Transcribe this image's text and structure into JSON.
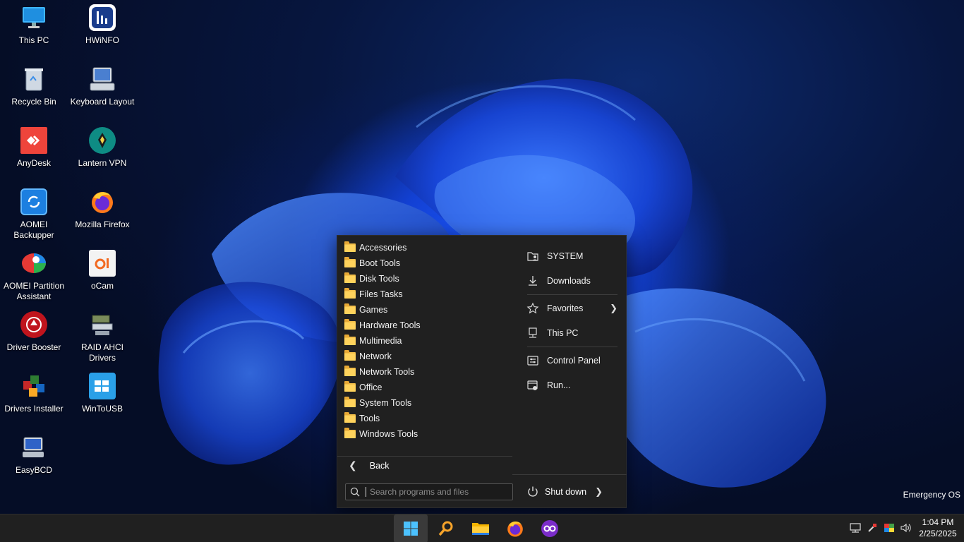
{
  "desktop": {
    "icons": [
      {
        "label": "This PC",
        "icon": "monitor-icon"
      },
      {
        "label": "HWiNFO",
        "icon": "hwinfo-icon"
      },
      {
        "label": "Recycle Bin",
        "icon": "recycle-bin-icon"
      },
      {
        "label": "Keyboard Layout",
        "icon": "keyboard-icon"
      },
      {
        "label": "AnyDesk",
        "icon": "anydesk-icon"
      },
      {
        "label": "Lantern VPN",
        "icon": "lantern-icon"
      },
      {
        "label": "AOMEI Backupper",
        "icon": "aomei-backupper-icon"
      },
      {
        "label": "Mozilla Firefox",
        "icon": "firefox-icon"
      },
      {
        "label": "AOMEI Partition Assistant",
        "icon": "aomei-partition-icon"
      },
      {
        "label": "oCam",
        "icon": "ocam-icon"
      },
      {
        "label": "Driver Booster",
        "icon": "driver-booster-icon"
      },
      {
        "label": "RAID AHCI Drivers",
        "icon": "raid-drivers-icon"
      },
      {
        "label": "Drivers Installer",
        "icon": "drivers-installer-icon"
      },
      {
        "label": "WinToUSB",
        "icon": "wintousb-icon"
      },
      {
        "label": "EasyBCD",
        "icon": "easybcd-icon"
      }
    ],
    "watermark": "Emergency OS"
  },
  "start_menu": {
    "programs": [
      "Accessories",
      "Boot Tools",
      "Disk Tools",
      "Files Tasks",
      "Games",
      "Hardware Tools",
      "Multimedia",
      "Network",
      "Network Tools",
      "Office",
      "System Tools",
      "Tools",
      "Windows Tools"
    ],
    "back_label": "Back",
    "search_placeholder": "Search programs and files",
    "right_panel": {
      "system": "SYSTEM",
      "downloads": "Downloads",
      "favorites": "Favorites",
      "this_pc": "This PC",
      "control_panel": "Control Panel",
      "run": "Run..."
    },
    "shutdown_label": "Shut down"
  },
  "taskbar": {
    "apps": [
      "start-icon",
      "search-icon",
      "file-explorer-icon",
      "firefox-icon",
      "app-icon"
    ],
    "clock": {
      "time": "1:04 PM",
      "date": "2/25/2025"
    }
  },
  "colors": {
    "menu_bg": "#202020",
    "taskbar_bg": "#202020",
    "folder_yellow": "#ffd35c",
    "accent_blue": "#0a7cff"
  }
}
